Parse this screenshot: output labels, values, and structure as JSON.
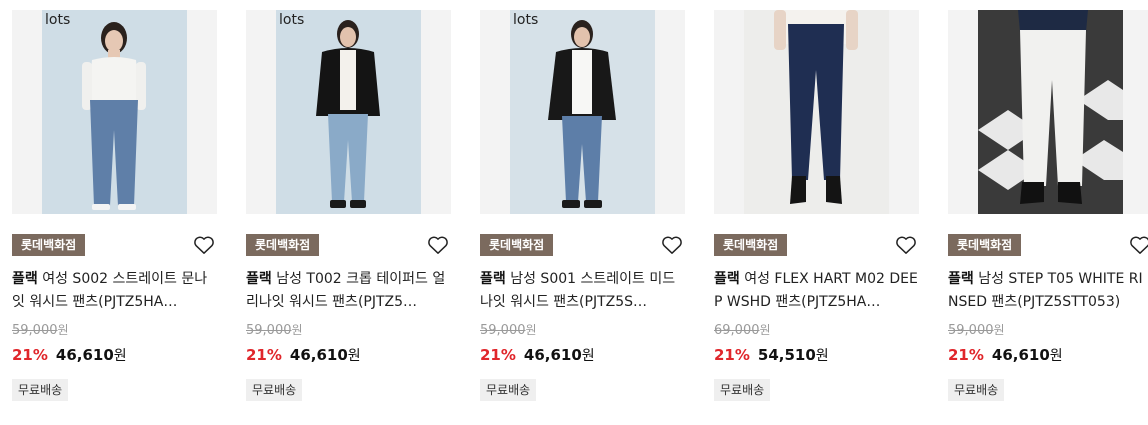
{
  "products": [
    {
      "brand_tag": "lots",
      "store": "롯데백화점",
      "brand": "플랙",
      "title": "여성 S002 스트레이트 문나잇 워시드 팬츠(PJTZ5HA…",
      "original_price": "59,000",
      "discount": "21%",
      "sale_price": "46,610",
      "shipping": "무료배송",
      "photo_bg": "#cfdde6"
    },
    {
      "brand_tag": "lots",
      "store": "롯데백화점",
      "brand": "플랙",
      "title": "남성 T002 크롭 테이퍼드 얼리나잇 워시드 팬츠(PJTZ5…",
      "original_price": "59,000",
      "discount": "21%",
      "sale_price": "46,610",
      "shipping": "무료배송",
      "photo_bg": "#cfdde6"
    },
    {
      "brand_tag": "lots",
      "store": "롯데백화점",
      "brand": "플랙",
      "title": "남성 S001 스트레이트 미드나잇 워시드 팬츠(PJTZ5S…",
      "original_price": "59,000",
      "discount": "21%",
      "sale_price": "46,610",
      "shipping": "무료배송",
      "photo_bg": "#d6e1e8"
    },
    {
      "brand_tag": "",
      "store": "롯데백화점",
      "brand": "플랙",
      "title": "여성 FLEX HART M02 DEEP WSHD 팬츠(PJTZ5HA…",
      "original_price": "69,000",
      "discount": "21%",
      "sale_price": "54,510",
      "shipping": "무료배송",
      "photo_bg": "#ededeb"
    },
    {
      "brand_tag": "",
      "store": "롯데백화점",
      "brand": "플랙",
      "title": "남성 STEP T05 WHITE RINSED 팬츠(PJTZ5STT053)",
      "original_price": "59,000",
      "discount": "21%",
      "sale_price": "46,610",
      "shipping": "무료배송",
      "photo_bg": "#3a3a3a"
    }
  ],
  "currency": "원",
  "colors": {
    "store_badge": "#7b6a5e",
    "discount": "#e0262b"
  }
}
